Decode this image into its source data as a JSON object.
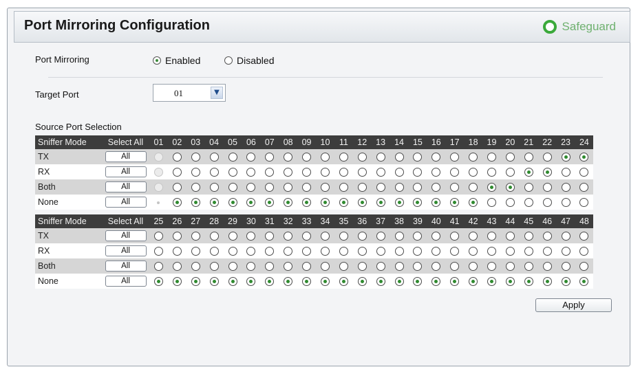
{
  "header": {
    "title": "Port Mirroring Configuration",
    "safeguard_label": "Safeguard"
  },
  "port_mirroring": {
    "label": "Port Mirroring",
    "options": [
      "Enabled",
      "Disabled"
    ],
    "selected": "Enabled"
  },
  "target_port": {
    "label": "Target Port",
    "value": "01"
  },
  "source": {
    "section_label": "Source Port Selection",
    "col_mode": "Sniffer Mode",
    "col_select_all": "Select All",
    "all_label": "All",
    "modes": [
      "TX",
      "RX",
      "Both",
      "None"
    ],
    "tables": [
      {
        "ports": [
          "01",
          "02",
          "03",
          "04",
          "05",
          "06",
          "07",
          "08",
          "09",
          "10",
          "11",
          "12",
          "13",
          "14",
          "15",
          "16",
          "17",
          "18",
          "19",
          "20",
          "21",
          "22",
          "23",
          "24"
        ],
        "selection": [
          "-",
          "None",
          "None",
          "None",
          "None",
          "None",
          "None",
          "None",
          "None",
          "None",
          "None",
          "None",
          "None",
          "None",
          "None",
          "None",
          "None",
          "None",
          "Both",
          "Both",
          "RX",
          "RX",
          "TX",
          "TX"
        ]
      },
      {
        "ports": [
          "25",
          "26",
          "27",
          "28",
          "29",
          "30",
          "31",
          "32",
          "33",
          "34",
          "35",
          "36",
          "37",
          "38",
          "39",
          "40",
          "41",
          "42",
          "43",
          "44",
          "45",
          "46",
          "47",
          "48"
        ],
        "selection": [
          "None",
          "None",
          "None",
          "None",
          "None",
          "None",
          "None",
          "None",
          "None",
          "None",
          "None",
          "None",
          "None",
          "None",
          "None",
          "None",
          "None",
          "None",
          "None",
          "None",
          "None",
          "None",
          "None",
          "None"
        ]
      }
    ]
  },
  "apply_label": "Apply"
}
